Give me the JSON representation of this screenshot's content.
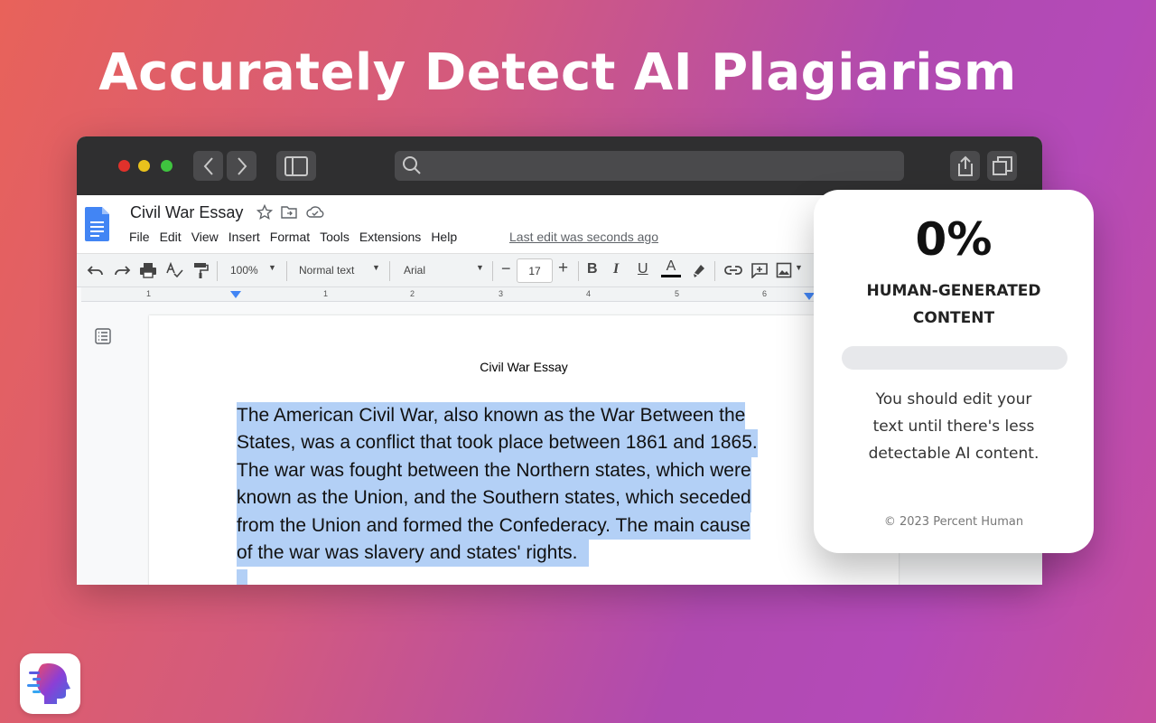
{
  "headline": "Accurately Detect AI Plagiarism",
  "browser": {
    "search_placeholder": ""
  },
  "docs": {
    "title": "Civil War Essay",
    "menu": [
      "File",
      "Edit",
      "View",
      "Insert",
      "Format",
      "Tools",
      "Extensions",
      "Help"
    ],
    "last_edit": "Last edit was seconds ago",
    "toolbar": {
      "zoom": "100%",
      "style": "Normal text",
      "font": "Arial",
      "font_size": "17"
    },
    "ruler_numbers": [
      "1",
      "1",
      "2",
      "3",
      "4",
      "5",
      "6"
    ],
    "page_heading": "Civil War Essay",
    "essay_lines": [
      "The American Civil War, also known as the War Between the",
      "States, was a conflict that took place between 1861 and 1865.",
      "The war was fought between the Northern states, which were",
      "known as the Union, and the Southern states, which seceded",
      "from the Union and formed the Confederacy. The main cause",
      "of the war was slavery and states' rights."
    ]
  },
  "card": {
    "percent": "0%",
    "percent_value": 0,
    "label": "HUMAN-GENERATED CONTENT",
    "message": "You should edit your text until there's less detectable AI content.",
    "copyright": "© 2023 Percent Human"
  },
  "colors": {
    "selection": "#b3d0f6",
    "docs_blue": "#4285f4",
    "titlebar": "#2f2f30"
  },
  "icons": [
    "search-icon",
    "back-icon",
    "forward-icon",
    "sidebar-icon",
    "share-icon",
    "tabs-icon",
    "docs-logo-icon",
    "star-icon",
    "move-folder-icon",
    "cloud-icon",
    "undo-icon",
    "redo-icon",
    "print-icon",
    "spellcheck-icon",
    "paint-format-icon",
    "bold-icon",
    "italic-icon",
    "underline-icon",
    "text-color-icon",
    "highlight-icon",
    "link-icon",
    "comment-icon",
    "image-icon",
    "outline-icon",
    "percent-human-logo-icon"
  ]
}
